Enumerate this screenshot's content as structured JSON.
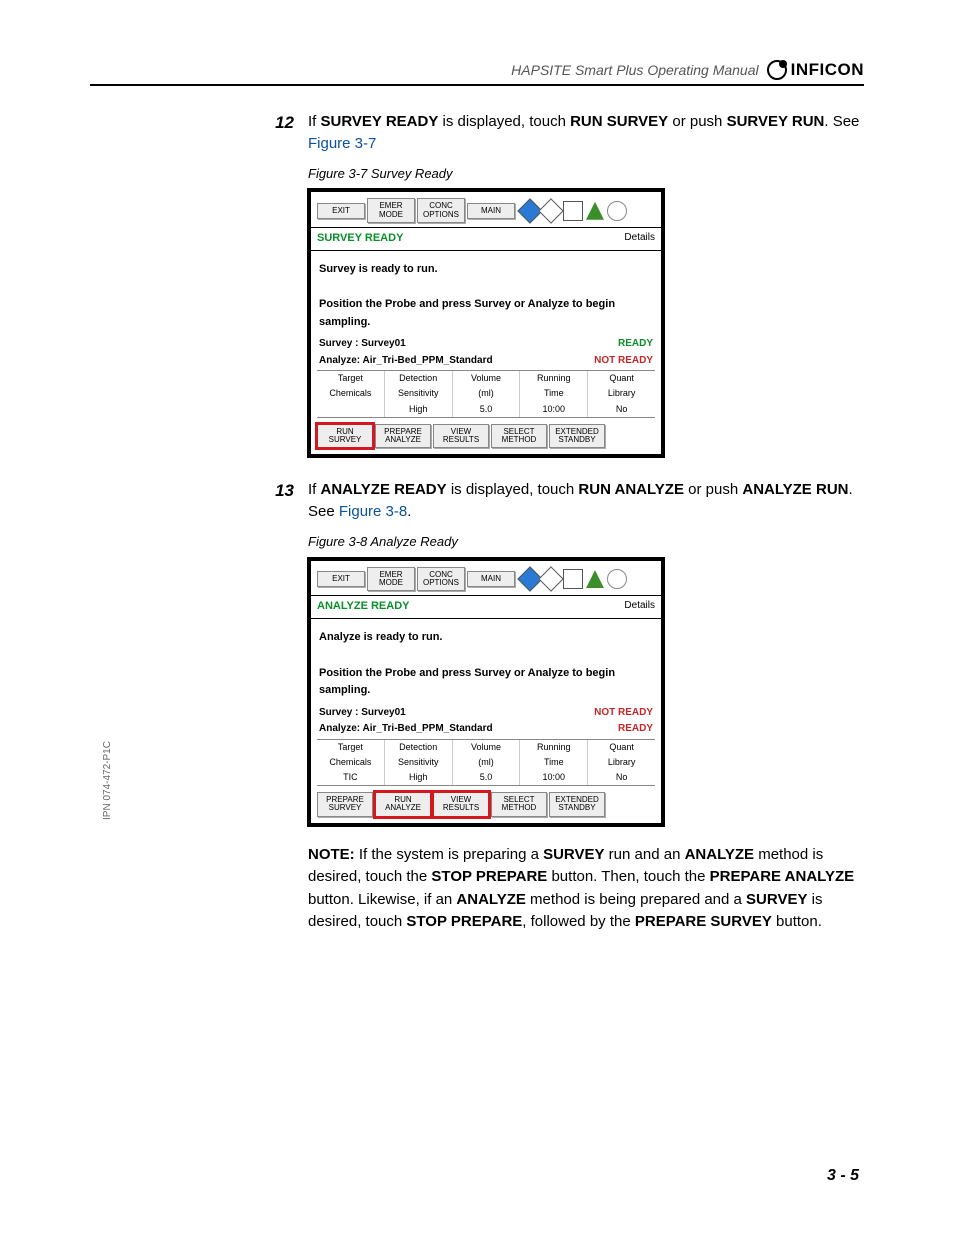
{
  "header": {
    "doc_title": "HAPSITE Smart Plus Operating Manual",
    "brand": "INFICON"
  },
  "side_pn": "IPN 074-472-P1C",
  "page_num": "3 - 5",
  "step12": {
    "num": "12",
    "text_a": "If ",
    "b1": "SURVEY READY",
    "text_b": " is displayed, touch ",
    "b2": "RUN SURVEY",
    "text_c": " or push ",
    "b3": "SURVEY RUN",
    "text_d": ". See ",
    "link": "Figure 3-7"
  },
  "fig7": {
    "cap": "Figure 3-7  Survey Ready",
    "tbar": {
      "exit": "EXIT",
      "emer": "EMER\nMODE",
      "conc": "CONC\nOPTIONS",
      "main": "MAIN"
    },
    "status": "SURVEY READY",
    "details": "Details",
    "msg1": "Survey is ready to run.",
    "msg2": "Position the Probe and press Survey or Analyze to begin sampling.",
    "srv_lbl": "Survey : Survey01",
    "srv_flag": "READY",
    "ana_lbl": "Analyze: Air_Tri-Bed_PPM_Standard",
    "ana_flag": "NOT READY",
    "hdrs": [
      "Target",
      "Detection",
      "Volume",
      "Running",
      "Quant"
    ],
    "r1": [
      "Chemicals",
      "Sensitivity",
      "(ml)",
      "Time",
      "Library"
    ],
    "r2": [
      "",
      "High",
      "5.0",
      "10:00",
      "No"
    ],
    "bbar": {
      "run": "RUN\nSURVEY",
      "prep": "PREPARE\nANALYZE",
      "view": "VIEW\nRESULTS",
      "sel": "SELECT\nMETHOD",
      "ext": "EXTENDED\nSTANDBY"
    }
  },
  "step13": {
    "num": "13",
    "text_a": "If ",
    "b1": "ANALYZE READY",
    "text_b": " is displayed, touch ",
    "b2": "RUN ANALYZE",
    "text_c": " or push ",
    "b3": "ANALYZE RUN",
    "text_d": ". See ",
    "link": "Figure 3-8",
    "text_e": "."
  },
  "fig8": {
    "cap": "Figure 3-8  Analyze Ready",
    "tbar": {
      "exit": "EXIT",
      "emer": "EMER\nMODE",
      "conc": "CONC\nOPTIONS",
      "main": "MAIN"
    },
    "status": "ANALYZE READY",
    "details": "Details",
    "msg1": "Analyze is ready to run.",
    "msg2": "Position the Probe and press Survey or Analyze to begin sampling.",
    "srv_lbl": "Survey : Survey01",
    "srv_flag": "NOT READY",
    "ana_lbl": "Analyze: Air_Tri-Bed_PPM_Standard",
    "ana_flag": "READY",
    "hdrs": [
      "Target",
      "Detection",
      "Volume",
      "Running",
      "Quant"
    ],
    "r1": [
      "Chemicals",
      "Sensitivity",
      "(ml)",
      "Time",
      "Library"
    ],
    "r2": [
      "TIC",
      "High",
      "5.0",
      "10:00",
      "No"
    ],
    "bbar": {
      "prep": "PREPARE\nSURVEY",
      "run": "RUN\nANALYZE",
      "view": "VIEW\nRESULTS",
      "sel": "SELECT\nMETHOD",
      "ext": "EXTENDED\nSTANDBY"
    }
  },
  "note": {
    "lbl": "NOTE:",
    "t1": " If the system is preparing a ",
    "b1": "SURVEY",
    "t2": " run and an ",
    "b2": "ANALYZE",
    "t3": " method is desired, touch the ",
    "b3": "STOP PREPARE",
    "t4": " button. Then, touch the ",
    "b4": "PREPARE ANALYZE",
    "t5": " button. Likewise, if an ",
    "b5": "ANALYZE",
    "t6": " method is being prepared and a ",
    "b6": "SURVEY",
    "t7": " is desired, touch ",
    "b7": "STOP PREPARE",
    "t8": ", followed by the ",
    "b8": "PREPARE SURVEY",
    "t9": " button."
  }
}
